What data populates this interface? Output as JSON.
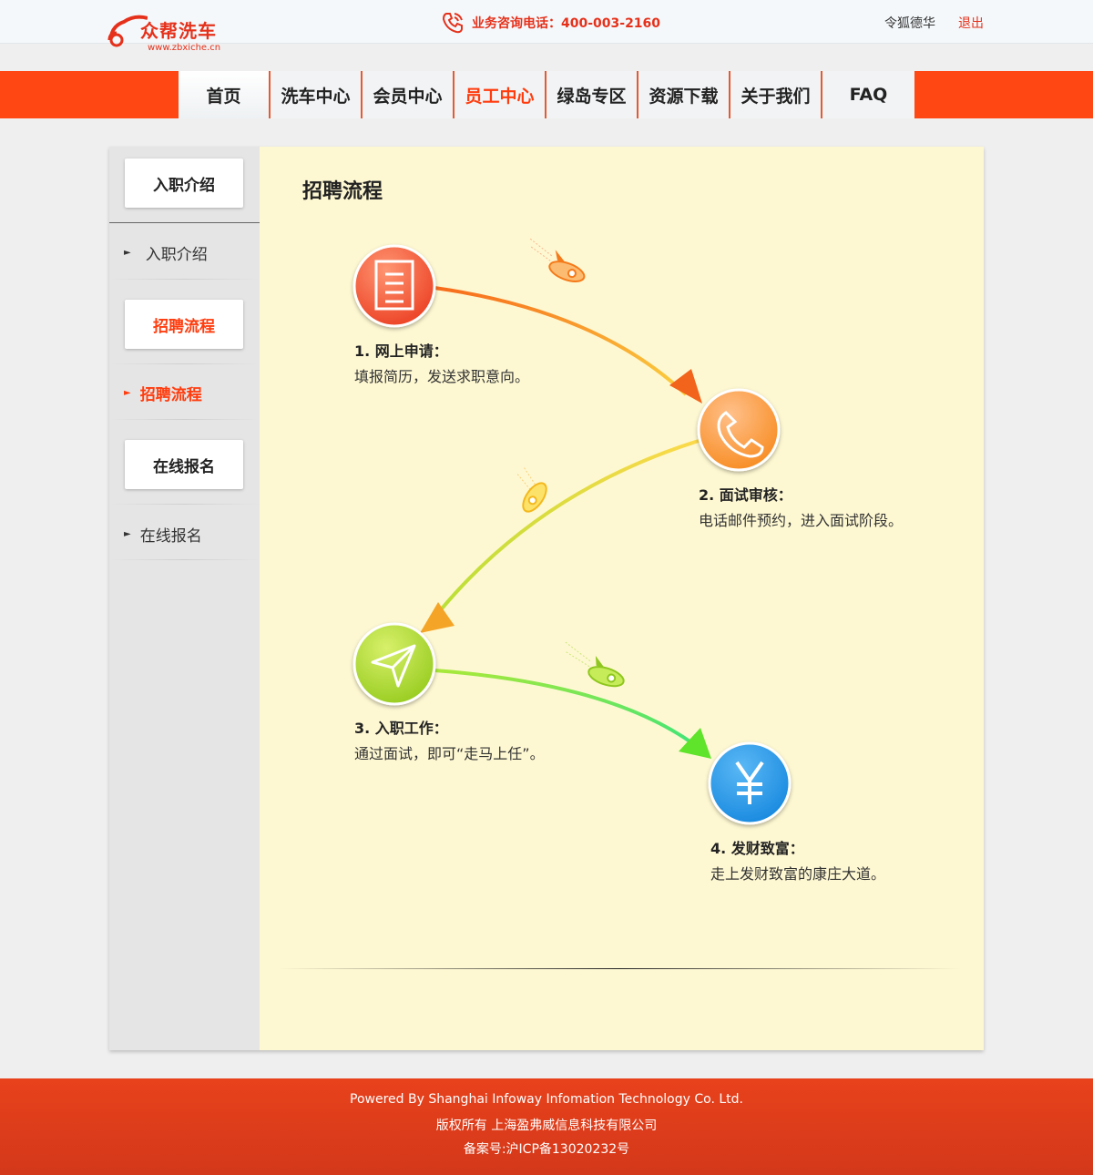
{
  "header": {
    "brand": "众帮洗车",
    "domain": "www.zbxiche.cn",
    "phone_text": "业务咨询电话：400-003-2160",
    "user_name": "令狐德华",
    "logout": "退出"
  },
  "nav": {
    "items": [
      {
        "label": "首页"
      },
      {
        "label": "洗车中心"
      },
      {
        "label": "会员中心"
      },
      {
        "label": "员工中心"
      },
      {
        "label": "绿岛专区"
      },
      {
        "label": "资源下载"
      },
      {
        "label": "关于我们"
      },
      {
        "label": "FAQ"
      }
    ],
    "active_index": 3
  },
  "sidebar": {
    "sections": [
      {
        "button": "入职介绍",
        "link": "入职介绍"
      },
      {
        "button": "招聘流程",
        "link": "招聘流程"
      },
      {
        "button": "在线报名",
        "link": "在线报名"
      }
    ],
    "active_section": 1
  },
  "main": {
    "title": "招聘流程",
    "steps": [
      {
        "title": "1. 网上申请：",
        "desc": "填报简历，发送求职意向。",
        "icon": "document-icon",
        "color": "#f04a2a"
      },
      {
        "title": "2. 面试审核：",
        "desc": "电话邮件预约，进入面试阶段。",
        "icon": "phone-icon",
        "color": "#fb8a1e"
      },
      {
        "title": "3. 入职工作：",
        "desc": "通过面试，即可“走马上任”。",
        "icon": "paper-plane-icon",
        "color": "#a6d62a"
      },
      {
        "title": "4. 发财致富：",
        "desc": "走上发财致富的康庄大道。",
        "icon": "yen-icon",
        "color": "#1f95e6"
      }
    ]
  },
  "footer": {
    "powered": "Powered By Shanghai Infoway Infomation Technology Co. Ltd.",
    "copyright": "版权所有 上海盈弗威信息科技有限公司",
    "icp": "备案号:沪ICP备13020232号"
  }
}
